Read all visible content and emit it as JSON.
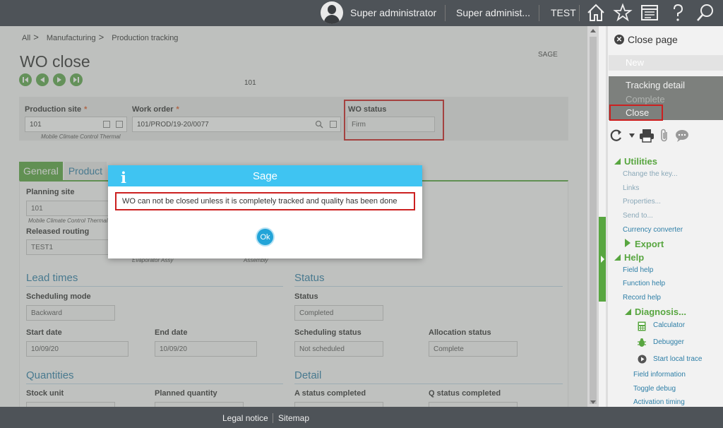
{
  "topbar": {
    "user": "Super administrator",
    "role": "Super administ...",
    "folder": "TEST",
    "icons": [
      "avatar",
      "home-icon",
      "star-icon",
      "display-icon",
      "help-icon",
      "search-icon"
    ]
  },
  "breadcrumb": [
    "All",
    "Manufacturing",
    "Production tracking"
  ],
  "breadcrumb_sep": ">",
  "page": {
    "title": "WO close",
    "company_tag": "SAGE",
    "record_number": "101"
  },
  "header": {
    "production_site_label": "Production site",
    "production_site_value": "101",
    "production_site_desc": "Mobile Climate Control Thermal",
    "work_order_label": "Work order",
    "work_order_value": "101/PROD/19-20/0077",
    "wo_status_label": "WO status",
    "wo_status_value": "Firm",
    "required_mark": "*"
  },
  "tabs": {
    "general": "General",
    "products": "Product"
  },
  "form": {
    "planning_site_label": "Planning site",
    "planning_site_value": "101",
    "planning_site_desc": "Mobile Climate Control Thermal",
    "released_routing_label": "Released routing",
    "released_routing_value": "TEST1",
    "routing_desc_1": "Evaporator Assy",
    "routing_desc_2": "Assembly",
    "lead_times_title": "Lead times",
    "scheduling_mode_label": "Scheduling mode",
    "scheduling_mode_value": "Backward",
    "start_date_label": "Start date",
    "start_date_value": "10/09/20",
    "end_date_label": "End date",
    "end_date_value": "10/09/20",
    "status_title": "Status",
    "status_label": "Status",
    "status_value": "Completed",
    "scheduling_status_label": "Scheduling status",
    "scheduling_status_value": "Not scheduled",
    "allocation_status_label": "Allocation status",
    "allocation_status_value": "Complete",
    "quantities_title": "Quantities",
    "stock_unit_label": "Stock unit",
    "planned_quantity_label": "Planned quantity",
    "detail_title": "Detail",
    "a_status_label": "A status completed",
    "q_status_label": "Q status completed"
  },
  "right_panel": {
    "close_page": "Close page",
    "new": "New",
    "tracking_detail": "Tracking detail",
    "complete": "Complete",
    "close": "Close",
    "utilities": "Utilities",
    "utilities_items": [
      "Change the key...",
      "Links",
      "Properties...",
      "Send to...",
      "Currency converter"
    ],
    "export": "Export",
    "help": "Help",
    "help_items": [
      "Field help",
      "Function help",
      "Record help"
    ],
    "diagnosis": "Diagnosis...",
    "diagnosis_items": [
      "Calculator",
      "Debugger",
      "Start local trace"
    ],
    "more_items": [
      "Field information",
      "Toggle debug",
      "Activation timing"
    ]
  },
  "dialog": {
    "title": "Sage",
    "info_glyph": "i",
    "message": "WO can not be closed unless it is completely tracked and quality has been done",
    "ok_label": "Ok"
  },
  "footer": {
    "legal": "Legal notice",
    "sitemap": "Sitemap"
  },
  "colors": {
    "topbar": "#4e5358",
    "accent_green": "#58a640",
    "link_blue": "#2e7fa7",
    "dialog_header": "#3fc4f2",
    "highlight_red": "#cc2020",
    "required_orange": "#e05d2b"
  }
}
